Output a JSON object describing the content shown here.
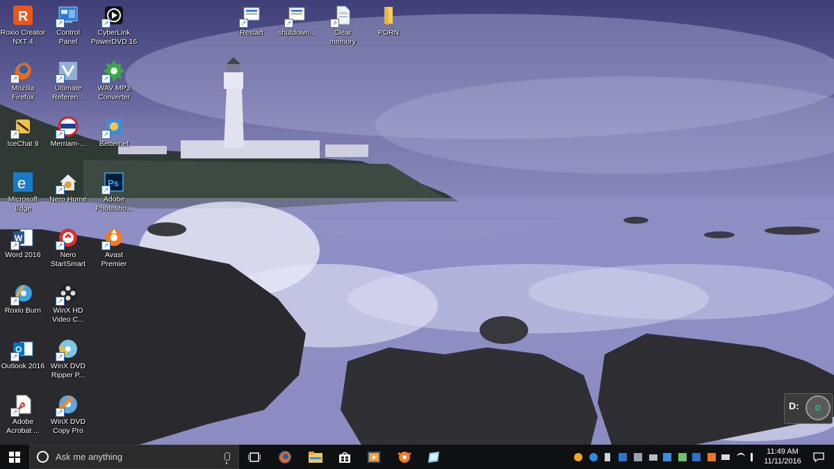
{
  "desktop": {
    "icons": [
      {
        "label": "Roxio Creator\nNXT 4",
        "icon": "roxio-creator-icon"
      },
      {
        "label": "Control\nPanel",
        "icon": "control-panel-icon"
      },
      {
        "label": "CyberLink\nPowerDVD 16",
        "icon": "powerdvd-icon"
      },
      {
        "label": "Mozilla\nFirefox",
        "icon": "firefox-icon"
      },
      {
        "label": "Ultimate\nReferen...",
        "icon": "ultimate-reference-icon"
      },
      {
        "label": "WAV MP3\nConverter",
        "icon": "wav-mp3-converter-icon"
      },
      {
        "label": "IceChat 9",
        "icon": "icechat-icon"
      },
      {
        "label": "Merriam-...",
        "icon": "merriam-webster-icon"
      },
      {
        "label": "Betternet",
        "icon": "betternet-icon"
      },
      {
        "label": "Microsoft\nEdge",
        "icon": "edge-icon"
      },
      {
        "label": "Nero Home",
        "icon": "nero-home-icon"
      },
      {
        "label": "Adobe\nPhotosho...",
        "icon": "photoshop-icon"
      },
      {
        "label": "Word 2016",
        "icon": "word-icon"
      },
      {
        "label": "Nero\nStartSmart",
        "icon": "nero-startsmart-icon"
      },
      {
        "label": "Avast\nPremier",
        "icon": "avast-icon"
      },
      {
        "label": "Roxio Burn",
        "icon": "roxio-burn-icon"
      },
      {
        "label": "WinX HD\nVideo C...",
        "icon": "winx-hd-video-icon"
      },
      {
        "label": "Outlook 2016",
        "icon": "outlook-icon"
      },
      {
        "label": "WinX DVD\nRipper P...",
        "icon": "winx-dvd-ripper-icon"
      },
      {
        "label": "Adobe\nAcrobat ...",
        "icon": "acrobat-icon"
      },
      {
        "label": "WinX DVD\nCopy Pro",
        "icon": "winx-dvd-copy-icon"
      },
      {
        "label": "Restart",
        "icon": "restart-shortcut-icon"
      },
      {
        "label": "shutdown...",
        "icon": "shutdown-shortcut-icon"
      },
      {
        "label": "Clear\nmemory",
        "icon": "clear-memory-icon"
      },
      {
        "label": "PORN",
        "icon": "folder-icon"
      }
    ],
    "drive_widget": {
      "label": "D:"
    }
  },
  "taskbar": {
    "search_placeholder": "Ask me anything",
    "pinned": [
      "task-view-icon",
      "firefox-icon",
      "file-explorer-icon",
      "store-icon",
      "media-player-icon",
      "avast-icon",
      "app-icon"
    ],
    "clock": {
      "time": "11:49 AM",
      "date": "11/11/2016"
    }
  },
  "colors": {
    "taskbar": "#0f1012",
    "search_box": "#2b2b2b",
    "wallpaper_tint": "#8483b6"
  }
}
